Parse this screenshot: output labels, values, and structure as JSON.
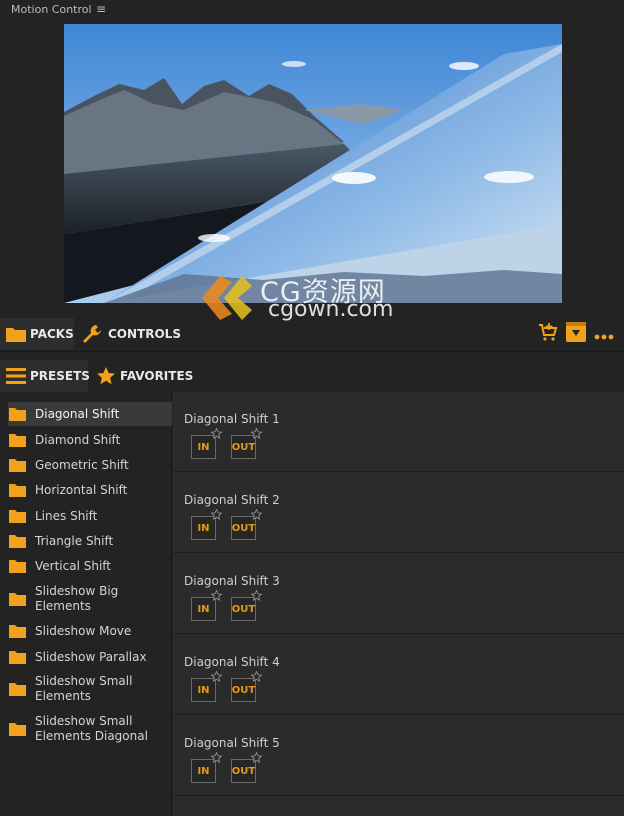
{
  "window": {
    "title": "Motion Control",
    "menu_icon": "hamburger-icon"
  },
  "watermark": {
    "cn": "CG资源网",
    "url": "cgown.com"
  },
  "nav": {
    "packs_label": "PACKS",
    "controls_label": "CONTROLS",
    "presets_label": "PRESETS",
    "favorites_label": "FAVORITES"
  },
  "sidebar": {
    "items": [
      {
        "label": "Diagonal Shift",
        "active": true
      },
      {
        "label": "Diamond Shift"
      },
      {
        "label": "Geometric Shift"
      },
      {
        "label": "Horizontal Shift"
      },
      {
        "label": "Lines Shift"
      },
      {
        "label": "Triangle Shift"
      },
      {
        "label": "Vertical Shift"
      },
      {
        "label": "Slideshow Big Elements"
      },
      {
        "label": "Slideshow Move"
      },
      {
        "label": "Slideshow Parallax"
      },
      {
        "label": "Slideshow Small Elements"
      },
      {
        "label": "Slideshow Small Elements Diagonal"
      }
    ]
  },
  "presets": [
    {
      "name": "Diagonal Shift 1",
      "in": "IN",
      "out": "OUT"
    },
    {
      "name": "Diagonal Shift 2",
      "in": "IN",
      "out": "OUT"
    },
    {
      "name": "Diagonal Shift 3",
      "in": "IN",
      "out": "OUT"
    },
    {
      "name": "Diagonal Shift 4",
      "in": "IN",
      "out": "OUT"
    },
    {
      "name": "Diagonal Shift 5",
      "in": "IN",
      "out": "OUT"
    }
  ],
  "colors": {
    "accent": "#f0a21c",
    "background": "#232323",
    "panel": "#2b2b2b"
  }
}
